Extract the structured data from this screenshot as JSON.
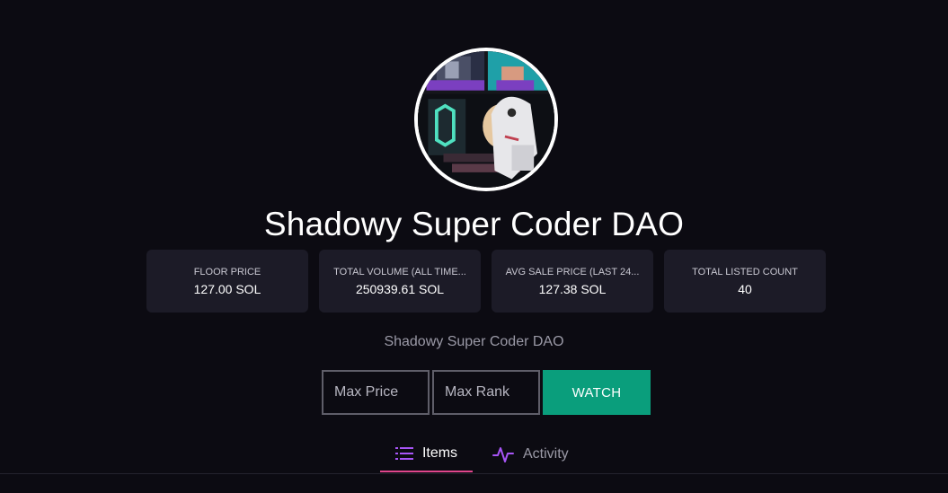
{
  "collection": {
    "name": "Shadowy Super Coder DAO",
    "description": "Shadowy Super Coder DAO"
  },
  "stats": [
    {
      "label": "FLOOR PRICE",
      "value": "127.00 SOL"
    },
    {
      "label": "TOTAL VOLUME (ALL TIME...",
      "value": "250939.61 SOL"
    },
    {
      "label": "AVG SALE PRICE (LAST 24...",
      "value": "127.38 SOL"
    },
    {
      "label": "TOTAL LISTED COUNT",
      "value": "40"
    }
  ],
  "filters": {
    "max_price_placeholder": "Max Price",
    "max_rank_placeholder": "Max Rank",
    "watch_label": "WATCH"
  },
  "tabs": [
    {
      "label": "Items",
      "icon": "list-icon",
      "active": true
    },
    {
      "label": "Activity",
      "icon": "activity-icon",
      "active": false
    }
  ],
  "colors": {
    "background": "#0c0b12",
    "card": "#1c1b27",
    "accent_button": "#0a9e7c",
    "active_tab_underline": "#e0468c",
    "icon_purple": "#a855f7"
  }
}
